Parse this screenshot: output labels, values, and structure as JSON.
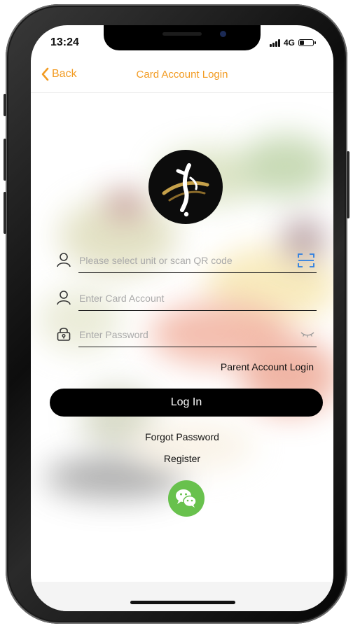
{
  "status_bar": {
    "time": "13:24",
    "network": "4G"
  },
  "nav": {
    "back_label": "Back",
    "title": "Card Account Login"
  },
  "form": {
    "unit": {
      "placeholder": "Please select unit or scan QR code",
      "value": ""
    },
    "card_account": {
      "placeholder": "Enter Card Account",
      "value": ""
    },
    "password": {
      "placeholder": "Enter Password",
      "value": ""
    }
  },
  "links": {
    "parent_account_login": "Parent Account Login",
    "forgot_password": "Forgot Password",
    "register": "Register"
  },
  "buttons": {
    "login_label": "Log In"
  },
  "icons": {
    "back": "chevron-left-icon",
    "user": "user-icon",
    "lock": "lock-icon",
    "scan": "scan-qr-icon",
    "eye": "eye-closed-icon",
    "wechat": "wechat-icon",
    "logo": "app-logo"
  },
  "colors": {
    "accent": "#f29b22",
    "login_button": "#000000",
    "wechat": "#68c14d"
  }
}
